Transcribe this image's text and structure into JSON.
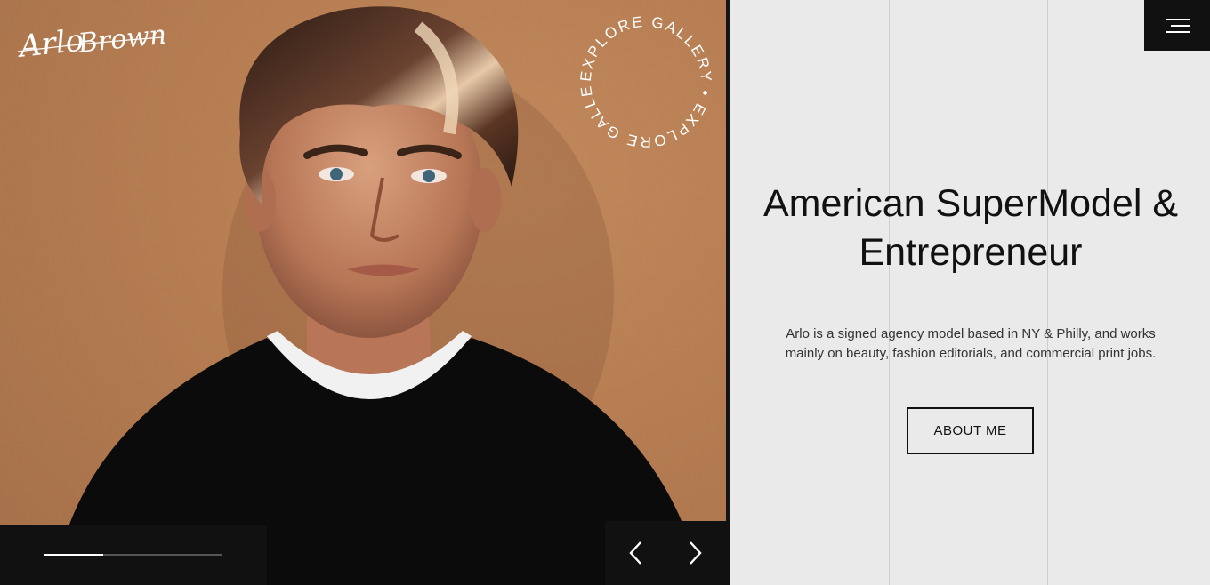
{
  "brand": {
    "logo_text": "Arlo Brown"
  },
  "hero": {
    "image_name": "portrait-of-model",
    "explore_badge": "EXPLORE GALLERY • EXPLORE GALLERY •",
    "progress_fraction": 0.33
  },
  "nav": {
    "prev_icon": "chevron-left-icon",
    "next_icon": "chevron-right-icon"
  },
  "menu": {
    "icon": "hamburger-menu-icon"
  },
  "main": {
    "headline_line1": "American SuperModel &",
    "headline_line2": "Entrepreneur",
    "description_line1": "Arlo is a signed agency model based in NY & Philly, and works",
    "description_line2": "mainly on beauty, fashion editorials, and commercial print jobs.",
    "cta_label": "ABOUT ME"
  },
  "colors": {
    "dark": "#111111",
    "light_bg": "#eaeaea",
    "wall": "#b77b4f",
    "white": "#ffffff"
  }
}
